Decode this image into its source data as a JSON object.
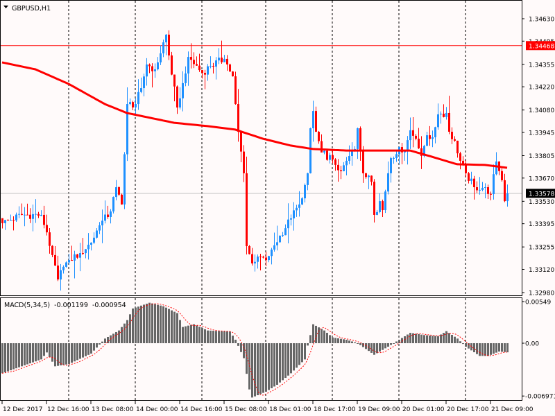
{
  "window": {
    "symbol_title": "GBPUSD,H1",
    "menu_icon": "triangle-down-icon"
  },
  "colors": {
    "background": "#fffafa",
    "bull": "#1e90ff",
    "bear": "#ff0000",
    "ma": "#ff0000",
    "hline": "#ff0000",
    "bid_line": "#c0c0c0",
    "histogram": "#666666",
    "signal": "#ff0000"
  },
  "chart_data": [
    {
      "type": "candlestick",
      "title": "GBPUSD,H1",
      "timeframe": "H1",
      "ylim": [
        1.3298,
        1.3463
      ],
      "price_ticks": [
        "1.34630",
        "1.34495",
        "1.34355",
        "1.34220",
        "1.34080",
        "1.33945",
        "1.33805",
        "1.33670",
        "1.33530",
        "1.33395",
        "1.33255",
        "1.33120",
        "1.32980"
      ],
      "candle_count": 183,
      "close_keypoints": [
        [
          0,
          1.33398
        ],
        [
          7,
          1.33448
        ],
        [
          14,
          1.33448
        ],
        [
          16,
          1.33343
        ],
        [
          18,
          1.33206
        ],
        [
          20,
          1.33059
        ],
        [
          22,
          1.33135
        ],
        [
          24,
          1.33176
        ],
        [
          28,
          1.33218
        ],
        [
          32,
          1.33281
        ],
        [
          35,
          1.33385
        ],
        [
          39,
          1.33469
        ],
        [
          41,
          1.33615
        ],
        [
          43,
          1.33511
        ],
        [
          45,
          1.34116
        ],
        [
          48,
          1.34116
        ],
        [
          50,
          1.34212
        ],
        [
          52,
          1.34354
        ],
        [
          55,
          1.34325
        ],
        [
          59,
          1.34534
        ],
        [
          60,
          1.34409
        ],
        [
          63,
          1.34095
        ],
        [
          65,
          1.34242
        ],
        [
          67,
          1.344
        ],
        [
          72,
          1.34304
        ],
        [
          75,
          1.34346
        ],
        [
          80,
          1.34388
        ],
        [
          83,
          1.34283
        ],
        [
          84,
          1.34116
        ],
        [
          85,
          1.33949
        ],
        [
          87,
          1.33699
        ],
        [
          88,
          1.3326
        ],
        [
          90,
          1.33156
        ],
        [
          92,
          1.33197
        ],
        [
          95,
          1.33176
        ],
        [
          97,
          1.33239
        ],
        [
          100,
          1.33323
        ],
        [
          104,
          1.33427
        ],
        [
          107,
          1.33511
        ],
        [
          109,
          1.33628
        ],
        [
          110,
          1.33699
        ],
        [
          111,
          1.3397
        ],
        [
          112,
          1.34074
        ],
        [
          113,
          1.33949
        ],
        [
          115,
          1.33824
        ],
        [
          119,
          1.33782
        ],
        [
          122,
          1.33711
        ],
        [
          124,
          1.33774
        ],
        [
          127,
          1.33845
        ],
        [
          128,
          1.3397
        ],
        [
          129,
          1.33836
        ],
        [
          130,
          1.33699
        ],
        [
          133,
          1.33648
        ],
        [
          134,
          1.33448
        ],
        [
          136,
          1.33531
        ],
        [
          137,
          1.33477
        ],
        [
          139,
          1.33699
        ],
        [
          140,
          1.3379
        ],
        [
          143,
          1.33857
        ],
        [
          145,
          1.33836
        ],
        [
          147,
          1.33958
        ],
        [
          149,
          1.33907
        ],
        [
          151,
          1.33803
        ],
        [
          153,
          1.33928
        ],
        [
          155,
          1.33916
        ],
        [
          157,
          1.34054
        ],
        [
          160,
          1.34062
        ],
        [
          161,
          1.33949
        ],
        [
          163,
          1.33895
        ],
        [
          165,
          1.33774
        ],
        [
          167,
          1.33699
        ],
        [
          170,
          1.33615
        ],
        [
          174,
          1.33615
        ],
        [
          176,
          1.33573
        ],
        [
          178,
          1.3377
        ],
        [
          180,
          1.33657
        ],
        [
          181,
          1.33531
        ],
        [
          182,
          1.33578
        ]
      ],
      "moving_average_keypoints": [
        [
          0,
          1.34367
        ],
        [
          12,
          1.34325
        ],
        [
          24,
          1.34237
        ],
        [
          37,
          1.34116
        ],
        [
          45,
          1.34062
        ],
        [
          62,
          1.34003
        ],
        [
          74,
          1.33983
        ],
        [
          84,
          1.33962
        ],
        [
          94,
          1.33907
        ],
        [
          104,
          1.33866
        ],
        [
          112,
          1.33845
        ],
        [
          124,
          1.33836
        ],
        [
          147,
          1.33836
        ],
        [
          154,
          1.33803
        ],
        [
          164,
          1.33753
        ],
        [
          174,
          1.33749
        ],
        [
          182,
          1.33732
        ]
      ],
      "horizontal_line": {
        "price": 1.34468,
        "label": "1.34468"
      },
      "current_price": {
        "price": 1.33578,
        "label": "1.33578"
      },
      "day_separator_candles": [
        24,
        48,
        72,
        95,
        119,
        143,
        167
      ],
      "time_labels": [
        {
          "candle": 0,
          "text": "12 Dec 2017"
        },
        {
          "candle": 16,
          "text": "12 Dec 16:00"
        },
        {
          "candle": 32,
          "text": "13 Dec 08:00"
        },
        {
          "candle": 48,
          "text": "14 Dec 00:00"
        },
        {
          "candle": 64,
          "text": "14 Dec 16:00"
        },
        {
          "candle": 80,
          "text": "15 Dec 08:00"
        },
        {
          "candle": 96,
          "text": "18 Dec 01:00"
        },
        {
          "candle": 112,
          "text": "18 Dec 17:00"
        },
        {
          "candle": 128,
          "text": "19 Dec 09:00"
        },
        {
          "candle": 144,
          "text": "20 Dec 01:00"
        },
        {
          "candle": 160,
          "text": "20 Dec 17:00"
        },
        {
          "candle": 176,
          "text": "21 Dec 09:00"
        }
      ]
    },
    {
      "type": "bar",
      "title": "MACD(5,34,5)",
      "legend_values": [
        "-0.001199",
        "-0.000954"
      ],
      "ylim": [
        -0.006971,
        0.00549
      ],
      "y_ticks": [
        "0.00549",
        "0.00",
        "-0.006971"
      ],
      "histogram_keypoints": [
        [
          0,
          -0.00397
        ],
        [
          7,
          -0.00305
        ],
        [
          14,
          -0.00214
        ],
        [
          16,
          -0.00122
        ],
        [
          19,
          -0.00305
        ],
        [
          24,
          -0.00275
        ],
        [
          32,
          -0.00137
        ],
        [
          37,
          0.00061
        ],
        [
          42,
          0.00168
        ],
        [
          45,
          0.00305
        ],
        [
          47,
          0.00458
        ],
        [
          53,
          0.00534
        ],
        [
          58,
          0.00488
        ],
        [
          63,
          0.00397
        ],
        [
          65,
          0.00214
        ],
        [
          69,
          0.0025
        ],
        [
          74,
          0.00168
        ],
        [
          82,
          0.00153
        ],
        [
          84,
          0.00046
        ],
        [
          87,
          -0.00198
        ],
        [
          89,
          -0.0061
        ],
        [
          90,
          -0.00717
        ],
        [
          95,
          -0.0064
        ],
        [
          99,
          -0.00549
        ],
        [
          104,
          -0.00397
        ],
        [
          109,
          -0.00214
        ],
        [
          110,
          -0.00031
        ],
        [
          111,
          0.00107
        ],
        [
          112,
          0.0025
        ],
        [
          116,
          0.00168
        ],
        [
          119,
          0.00076
        ],
        [
          124,
          0.00046
        ],
        [
          128,
          0.0
        ],
        [
          134,
          -0.00153
        ],
        [
          139,
          -0.00046
        ],
        [
          143,
          0.00046
        ],
        [
          147,
          0.00137
        ],
        [
          152,
          0.00107
        ],
        [
          157,
          0.00092
        ],
        [
          160,
          0.00159
        ],
        [
          164,
          0.00061
        ],
        [
          167,
          -0.00046
        ],
        [
          172,
          -0.00168
        ],
        [
          175,
          -0.00168
        ],
        [
          179,
          -0.0011
        ],
        [
          182,
          -0.0012
        ]
      ],
      "signal_period": 5
    }
  ]
}
